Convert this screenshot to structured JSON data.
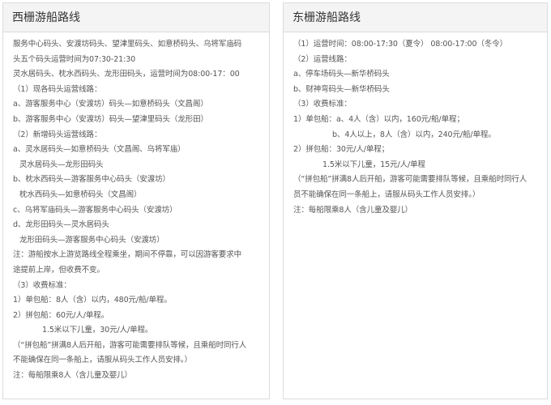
{
  "left_panel": {
    "title": "西栅游船路线",
    "lines": [
      {
        "text": "服务中心码头、安渡坊码头、望津里码头、如意桥码头、乌将军庙码",
        "indent": 0
      },
      {
        "text": "头五个码头运营时间为07:30-21:30",
        "indent": 0
      },
      {
        "text": "灵水居码头、枕水西码头、龙形田码头，运营时间为08:00-17：00",
        "indent": 0
      },
      {
        "text": "（1）现各码头运营线路：",
        "indent": 0
      },
      {
        "text": "a、游客服务中心（安渡坊）码头—如意桥码头（文昌阁）",
        "indent": 0
      },
      {
        "text": "b、游客服务中心（安渡坊）码头—望津里码头（龙形田）",
        "indent": 0
      },
      {
        "text": "（2）新增码头运营线路：",
        "indent": 0
      },
      {
        "text": "a、灵水居码头—如意桥码头（文昌阁、乌将军庙）",
        "indent": 0
      },
      {
        "text": "灵水居码头—龙形田码头",
        "indent": 1
      },
      {
        "text": "b、枕水西码头—游客服务中心码头（安渡坊）",
        "indent": 0
      },
      {
        "text": "枕水西码头—如意桥码头（文昌阁）",
        "indent": 1
      },
      {
        "text": "c、乌将军庙码头—游客服务中心码头（安渡坊）",
        "indent": 0
      },
      {
        "text": "d、龙形田码头—灵水居码头",
        "indent": 0
      },
      {
        "text": "龙形田码头—游客服务中心码头（安渡坊）",
        "indent": 1
      },
      {
        "text": "注：游船按水上游览路线全程乘坐，期间不停靠，可以因游客要求中",
        "indent": 0
      },
      {
        "text": "途提前上岸，但收费不变。",
        "indent": 0
      },
      {
        "text": "（3）收费标准：",
        "indent": 0
      },
      {
        "text": "1）单包船：8人（含）以内，480元/船/单程。",
        "indent": 0
      },
      {
        "text": "2）拼包船：60元/人/单程。",
        "indent": 0
      },
      {
        "text": "1.5米以下儿童，30元/人/单程。",
        "indent": 2
      },
      {
        "text": "（“拼包船”拼满8人后开船，游客可能需要排队等候，且乘船时同行人",
        "indent": 0
      },
      {
        "text": "不能确保在同一条船上，请服从码头工作人员安排。）",
        "indent": 0
      },
      {
        "text": "注：每船限乘8人（含儿童及婴儿）",
        "indent": 0
      }
    ]
  },
  "right_panel": {
    "title": "东栅游船路线",
    "lines": [
      {
        "text": "（1）运营时间：08:00-17:30（夏令） 08:00-17:00（冬令）",
        "indent": 0
      },
      {
        "text": "（2）运营线路：",
        "indent": 0
      },
      {
        "text": "a、停车场码头—新华桥码头",
        "indent": 0
      },
      {
        "text": "b、财神弯码头—新华桥码头",
        "indent": 0
      },
      {
        "text": "（3）收费标准：",
        "indent": 0
      },
      {
        "text": "1）单包船：a、4人（含）以内，160元/船/单程；",
        "indent": 0
      },
      {
        "text": "b、4人以上，8人（含）以内，240元/船/单程。",
        "indent": 3
      },
      {
        "text": "2）拼包船：30元/人/单程；",
        "indent": 0
      },
      {
        "text": "1.5米以下儿童，15元/人/单程",
        "indent": 2
      },
      {
        "text": "（“拼包船”拼满8人后开船，游客可能需要排队等候，且乘船时同行人",
        "indent": 0
      },
      {
        "text": "员不能确保在同一条船上，请服从码头工作人员安排。）",
        "indent": 0
      },
      {
        "text": "注：每船限乘8人（含儿童及婴儿）",
        "indent": 0
      }
    ]
  }
}
